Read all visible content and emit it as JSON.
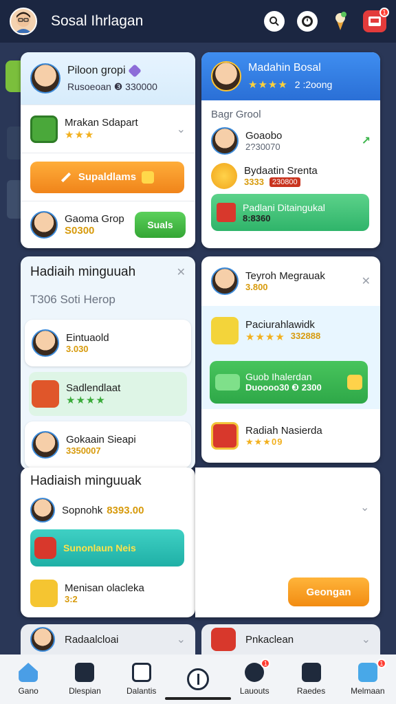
{
  "header": {
    "title": "Sosal Ihrlagan",
    "notification_count": "1"
  },
  "colors": {
    "header_bg": "#1b2641",
    "accent_orange": "#f59a1b",
    "accent_green": "#4cbd4c",
    "accent_teal": "#1fc9b8",
    "accent_blue": "#2f7ee0"
  },
  "card1": {
    "title": "Piloon gropi",
    "subtitle": "Rusoeoan ❸ 330000",
    "row1": {
      "title": "Mrakan Sdapart",
      "stars": "★★★"
    },
    "button_label": "Supaldlams",
    "row3": {
      "title": "Gaoma Grop",
      "value": "S0300",
      "button": "Suals"
    }
  },
  "card2": {
    "title": "Madahin Bosal",
    "stars": "★★★★",
    "count": "2 :2oong",
    "section": "Bagr Grool",
    "row1": {
      "title": "Goaobo",
      "value": "2?30070"
    },
    "row2": {
      "title": "Bydaatin Srenta",
      "value1": "3333",
      "value2": "230800"
    },
    "promo": {
      "title": "Padlani Ditaingukal",
      "value": "8:8360"
    }
  },
  "card3": {
    "title": "Hadiaih minguuah",
    "subtitle": "T306 Soti Herop",
    "items": [
      {
        "title": "Eintuaold",
        "value": "3.030"
      },
      {
        "title": "Sadlendlaat",
        "stars": "★★★★"
      },
      {
        "title": "Gokaain Sieapi",
        "value": "3350007"
      }
    ]
  },
  "card4": {
    "row1": {
      "title": "Teyroh Megrauak",
      "value": "3.800"
    },
    "row2": {
      "title": "Paciurahlawidk",
      "stars": "★★★★",
      "value": "332888"
    },
    "promo": {
      "title": "Guob Ihalerdan",
      "value": "Duoooo30 ❸ 2300"
    },
    "row4": {
      "title": "Radiah Nasierda",
      "value": "★★★09"
    },
    "button": "Geongan"
  },
  "card5": {
    "title": "Hadiaish minguuak",
    "row1": {
      "title": "Sopnohk",
      "value": "8393.00"
    },
    "promo": {
      "title": "Sunonlaun Neis"
    },
    "row3": {
      "title": "Menisan olacleka",
      "value": "3:2"
    }
  },
  "peek": {
    "left": {
      "title": "Radaalcloai"
    },
    "right": {
      "title": "Pnkaclean"
    }
  },
  "nav": {
    "items": [
      {
        "label": "Gano"
      },
      {
        "label": "Dlespian"
      },
      {
        "label": "Dalantis"
      },
      {
        "label": ""
      },
      {
        "label": "Lauouts"
      },
      {
        "label": "Raedes"
      },
      {
        "label": "Melmaan"
      }
    ],
    "badge1": "1",
    "badge2": "1"
  }
}
